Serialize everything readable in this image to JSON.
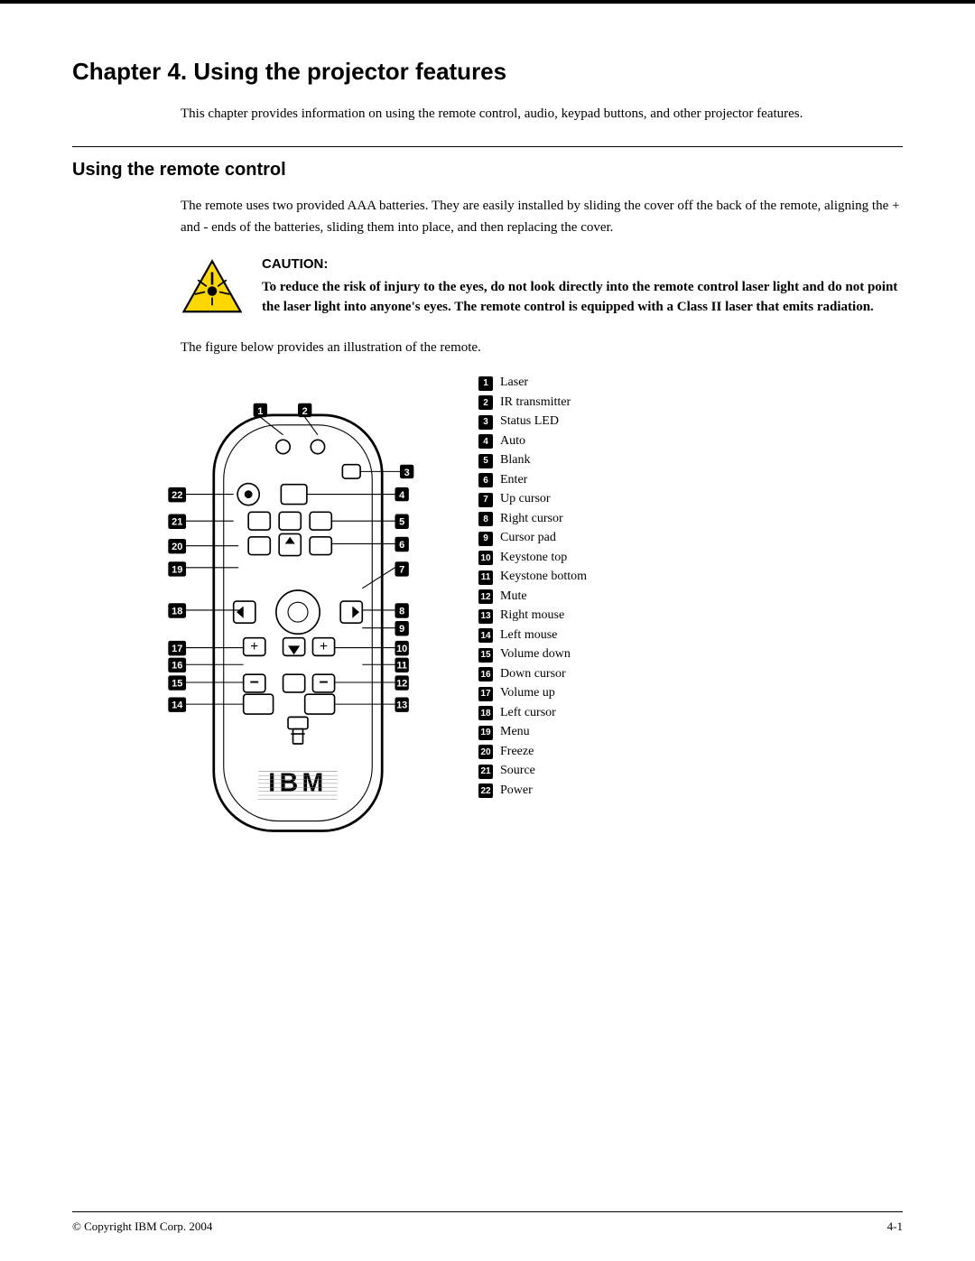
{
  "page": {
    "top_border": true,
    "chapter_title": "Chapter 4. Using the projector features",
    "intro_text": "This chapter provides information on using the remote control, audio, keypad buttons, and other projector features.",
    "section_title": "Using the remote control",
    "section_body": "The remote uses two provided AAA batteries. They are easily installed by sliding the cover off the back of the remote, aligning the + and - ends of the batteries, sliding them into place, and then replacing the cover.",
    "caution_label": "CAUTION:",
    "caution_text": "To reduce the risk of injury to the eyes, do not look directly into the remote control laser light and do not point the laser light into anyone's eyes. The remote control is equipped with a Class II laser that emits radiation.",
    "figure_caption": "The figure below provides an illustration of the remote.",
    "footer_copyright": "© Copyright IBM Corp.  2004",
    "footer_page": "4-1"
  },
  "legend": [
    {
      "num": "1",
      "label": "Laser"
    },
    {
      "num": "2",
      "label": "IR transmitter"
    },
    {
      "num": "3",
      "label": "Status LED"
    },
    {
      "num": "4",
      "label": "Auto"
    },
    {
      "num": "5",
      "label": "Blank"
    },
    {
      "num": "6",
      "label": "Enter"
    },
    {
      "num": "7",
      "label": "Up cursor"
    },
    {
      "num": "8",
      "label": "Right cursor"
    },
    {
      "num": "9",
      "label": "Cursor pad"
    },
    {
      "num": "10",
      "label": "Keystone top"
    },
    {
      "num": "11",
      "label": "Keystone bottom"
    },
    {
      "num": "12",
      "label": "Mute"
    },
    {
      "num": "13",
      "label": "Right mouse"
    },
    {
      "num": "14",
      "label": "Left mouse"
    },
    {
      "num": "15",
      "label": "Volume down"
    },
    {
      "num": "16",
      "label": "Down cursor"
    },
    {
      "num": "17",
      "label": "Volume up"
    },
    {
      "num": "18",
      "label": "Left cursor"
    },
    {
      "num": "19",
      "label": "Menu"
    },
    {
      "num": "20",
      "label": "Freeze"
    },
    {
      "num": "21",
      "label": "Source"
    },
    {
      "num": "22",
      "label": "Power"
    }
  ],
  "diagram_labels": {
    "numbered_badges": [
      "1",
      "2",
      "3",
      "4",
      "5",
      "6",
      "7",
      "8",
      "9",
      "10",
      "11",
      "12",
      "13",
      "14",
      "15",
      "16",
      "17",
      "18",
      "19",
      "20",
      "21",
      "22"
    ]
  }
}
